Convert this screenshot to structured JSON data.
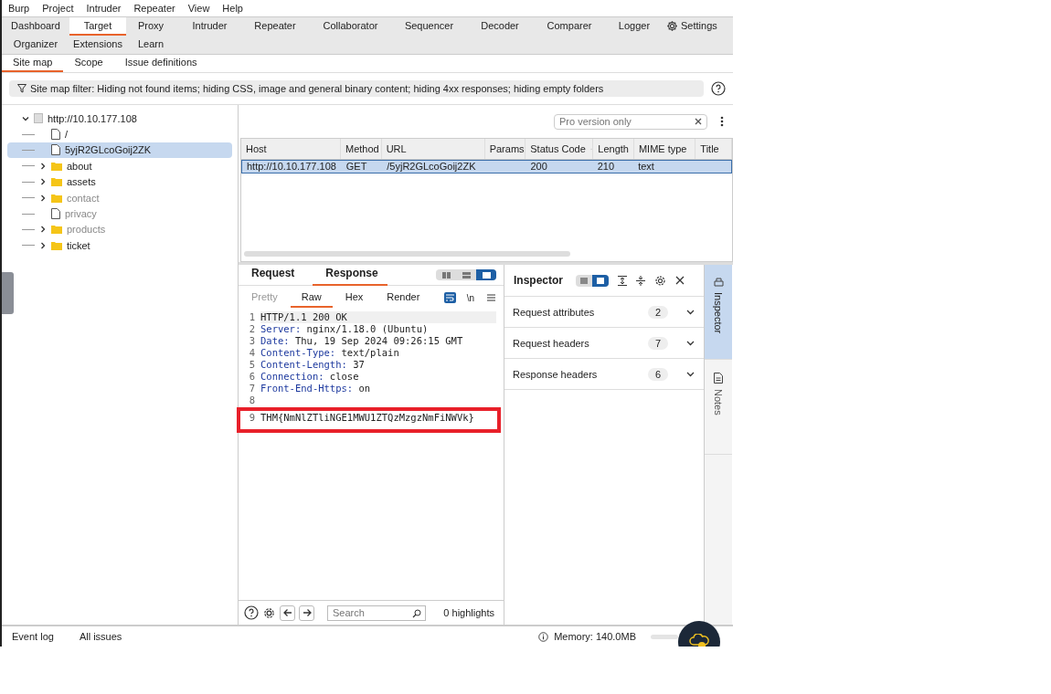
{
  "menu": [
    "Burp",
    "Project",
    "Intruder",
    "Repeater",
    "View",
    "Help"
  ],
  "tabs": [
    {
      "label": "Dashboard",
      "selected": false
    },
    {
      "label": "Target",
      "selected": true
    },
    {
      "label": "Proxy",
      "selected": false
    },
    {
      "label": "Intruder",
      "selected": false
    },
    {
      "label": "Repeater",
      "selected": false
    },
    {
      "label": "Collaborator",
      "selected": false
    },
    {
      "label": "Sequencer",
      "selected": false
    },
    {
      "label": "Decoder",
      "selected": false
    },
    {
      "label": "Comparer",
      "selected": false
    },
    {
      "label": "Logger",
      "selected": false
    },
    {
      "label": "Organizer",
      "selected": false
    },
    {
      "label": "Extensions",
      "selected": false
    },
    {
      "label": "Learn",
      "selected": false
    }
  ],
  "settings_label": "Settings",
  "subtabs": [
    {
      "label": "Site map",
      "selected": true
    },
    {
      "label": "Scope",
      "selected": false
    },
    {
      "label": "Issue definitions",
      "selected": false
    }
  ],
  "filter": "Site map filter: Hiding not found items; hiding CSS, image and general binary content; hiding 4xx responses; hiding empty folders",
  "tree": {
    "label": "http://10.10.177.108",
    "expanded": true,
    "children": [
      {
        "label": "/",
        "kind": "file",
        "selected": false,
        "dimmed": false
      },
      {
        "label": "5yjR2GLcoGoij2ZK",
        "kind": "file",
        "selected": true,
        "dimmed": false
      },
      {
        "label": "about",
        "kind": "folder",
        "selected": false,
        "dimmed": false,
        "expanded": false
      },
      {
        "label": "assets",
        "kind": "folder",
        "selected": false,
        "dimmed": false,
        "expanded": false
      },
      {
        "label": "contact",
        "kind": "folder",
        "selected": false,
        "dimmed": true,
        "expanded": false
      },
      {
        "label": "privacy",
        "kind": "file",
        "selected": false,
        "dimmed": true
      },
      {
        "label": "products",
        "kind": "folder",
        "selected": false,
        "dimmed": true,
        "expanded": false
      },
      {
        "label": "ticket",
        "kind": "folder",
        "selected": false,
        "dimmed": false,
        "expanded": false
      }
    ]
  },
  "table": {
    "search": {
      "placeholder": "Pro version only"
    },
    "columns": [
      {
        "label": "Host",
        "sorted": false
      },
      {
        "label": "Method",
        "sorted": false
      },
      {
        "label": "URL",
        "sorted": false
      },
      {
        "label": "Params",
        "sorted": false
      },
      {
        "label": "Status Code",
        "sorted": true
      },
      {
        "label": "Length",
        "sorted": false
      },
      {
        "label": "MIME type",
        "sorted": false
      },
      {
        "label": "Title",
        "sorted": false
      }
    ],
    "rows": [
      {
        "host": "http://10.10.177.108",
        "method": "GET",
        "url": "/5yjR2GLcoGoij2ZK",
        "status_code": "200",
        "length": "210",
        "mime_type": "text",
        "selected": true
      }
    ]
  },
  "editor": {
    "tabs": [
      {
        "label": "Request",
        "selected": false
      },
      {
        "label": "Response",
        "selected": true
      }
    ],
    "layout_buttons": [
      {
        "selected": false
      },
      {
        "selected": false
      },
      {
        "selected": true
      }
    ],
    "views": [
      {
        "label": "Pretty",
        "selected": false,
        "disabled": true
      },
      {
        "label": "Raw",
        "selected": true,
        "disabled": false
      },
      {
        "label": "Hex",
        "selected": false,
        "disabled": false
      },
      {
        "label": "Render",
        "selected": false,
        "disabled": false
      }
    ],
    "wrap_on": true,
    "newline_label": "\\n",
    "lines": [
      {
        "number": "1",
        "kind": "status",
        "text": "HTTP/1.1 200 OK",
        "annotated": false
      },
      {
        "number": "2",
        "kind": "header",
        "name": "Server:",
        "text": "nginx/1.18.0 (Ubuntu)",
        "annotated": false
      },
      {
        "number": "3",
        "kind": "header",
        "name": "Date:",
        "text": "Thu, 19 Sep 2024 09:26:15 GMT",
        "annotated": false
      },
      {
        "number": "4",
        "kind": "header",
        "name": "Content-Type:",
        "text": "text/plain",
        "annotated": false
      },
      {
        "number": "5",
        "kind": "header",
        "name": "Content-Length:",
        "text": "37",
        "annotated": false
      },
      {
        "number": "6",
        "kind": "header",
        "name": "Connection:",
        "text": "close",
        "annotated": false
      },
      {
        "number": "7",
        "kind": "header",
        "name": "Front-End-Https:",
        "text": "on",
        "annotated": false
      },
      {
        "number": "8",
        "kind": "blank",
        "annotated": false
      },
      {
        "number": "9",
        "kind": "body",
        "text": "THM{NmNlZTliNGE1MWU1ZTQzMzgzNmFiNWVk}",
        "annotated": true
      }
    ],
    "search": {
      "placeholder": "Search"
    },
    "highlights": "0 highlights"
  },
  "inspector": {
    "title": "Inspector",
    "layout_buttons": [
      {
        "selected": false
      },
      {
        "selected": true
      }
    ],
    "sections": [
      {
        "label": "Request attributes",
        "count": "2",
        "expanded": false
      },
      {
        "label": "Request headers",
        "count": "7",
        "expanded": false
      },
      {
        "label": "Response headers",
        "count": "6",
        "expanded": false
      }
    ]
  },
  "side_tabs": [
    {
      "label": "Inspector",
      "selected": true
    },
    {
      "label": "Notes",
      "selected": false
    }
  ],
  "status_bar": {
    "items": [
      "Event log",
      "All issues"
    ],
    "memory": "Memory: 140.0MB"
  }
}
